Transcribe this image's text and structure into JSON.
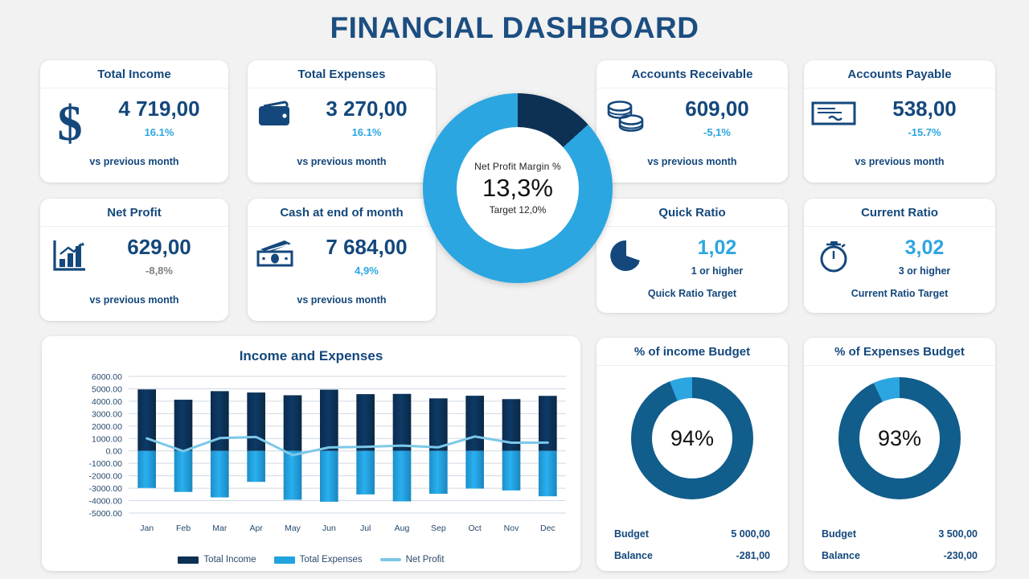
{
  "header": {
    "title": "FINANCIAL DASHBOARD"
  },
  "colors": {
    "navy": "#14487c",
    "dark_navy": "#0d3055",
    "bright_blue": "#2ba6e0",
    "light_blue": "#7cc8e8",
    "teal_blue": "#115d8c",
    "gray_text": "#808080",
    "page_bg": "#f2f2f2"
  },
  "kpis": [
    {
      "title": "Total Income",
      "icon": "dollar-sign-icon",
      "value": "4 719,00",
      "delta": "16.1%",
      "delta_tone": "blue",
      "footer": "vs previous month"
    },
    {
      "title": "Total Expenses",
      "icon": "wallet-icon",
      "value": "3 270,00",
      "delta": "16.1%",
      "delta_tone": "blue",
      "footer": "vs previous month"
    },
    {
      "title": "Accounts Receivable",
      "icon": "coins-stack-icon",
      "value": "609,00",
      "delta": "-5,1%",
      "delta_tone": "blue",
      "footer": "vs previous month"
    },
    {
      "title": "Accounts Payable",
      "icon": "cheque-icon",
      "value": "538,00",
      "delta": "-15.7%",
      "delta_tone": "blue",
      "footer": "vs previous month"
    },
    {
      "title": "Net Profit",
      "icon": "bar-chart-arrow-icon",
      "value": "629,00",
      "delta": "-8,8%",
      "delta_tone": "gray",
      "footer": "vs previous month"
    },
    {
      "title": "Cash at end of month",
      "icon": "banknotes-icon",
      "value": "7 684,00",
      "delta": "4,9%",
      "delta_tone": "blue",
      "footer": "vs previous month"
    }
  ],
  "ratios": [
    {
      "title": "Quick Ratio",
      "icon": "pie-chart-icon",
      "value": "1,02",
      "sub": "1 or higher",
      "footer": "Quick Ratio Target"
    },
    {
      "title": "Current Ratio",
      "icon": "stopwatch-icon",
      "value": "3,02",
      "sub": "3 or higher",
      "footer": "Current Ratio Target"
    }
  ],
  "net_profit_margin": {
    "label": "Net  Profit Margin %",
    "value": "13,3%",
    "target": "Target 12,0%",
    "percent": 13.3
  },
  "chart_data": {
    "type": "bar",
    "title": "Income and  Expenses",
    "xlabel": "",
    "ylabel": "",
    "ylim": [
      -5000,
      6000
    ],
    "ytick_step": 1000,
    "grid": true,
    "legend_position": "bottom",
    "categories": [
      "Jan",
      "Feb",
      "Mar",
      "Apr",
      "May",
      "Jun",
      "Jul",
      "Aug",
      "Sep",
      "Oct",
      "Nov",
      "Dec"
    ],
    "ytick_labels": [
      "6000.00",
      "5000.00",
      "4000.00",
      "3000.00",
      "2000.00",
      "1000.00",
      "0.00",
      "-1000.00",
      "-2000.00",
      "-3000.00",
      "-4000.00",
      "-5000.00"
    ],
    "series": [
      {
        "name": "Total Income",
        "type": "bar",
        "color": "#0d3055",
        "values": [
          4950,
          4120,
          4810,
          4700,
          4480,
          4930,
          4570,
          4590,
          4230,
          4440,
          4170,
          4430
        ]
      },
      {
        "name": "Total Expenses",
        "type": "bar",
        "color": "#21a3dd",
        "values": [
          -2980,
          -3300,
          -3740,
          -2490,
          -3930,
          -4090,
          -3500,
          -4060,
          -3450,
          -3030,
          -3180,
          -3650
        ]
      },
      {
        "name": "Net Profit",
        "type": "line",
        "color": "#7cc8e8",
        "values": [
          1010,
          -20,
          1030,
          1120,
          -340,
          280,
          330,
          430,
          290,
          1160,
          660,
          670
        ]
      }
    ]
  },
  "budget_cards": [
    {
      "title": "% of income Budget",
      "percent_label": "94%",
      "percent": 94,
      "rows": [
        {
          "label": "Budget",
          "value": "5 000,00"
        },
        {
          "label": "Balance",
          "value": "-281,00"
        }
      ]
    },
    {
      "title": "% of Expenses Budget",
      "percent_label": "93%",
      "percent": 93,
      "rows": [
        {
          "label": "Budget",
          "value": "3 500,00"
        },
        {
          "label": "Balance",
          "value": "-230,00"
        }
      ]
    }
  ]
}
